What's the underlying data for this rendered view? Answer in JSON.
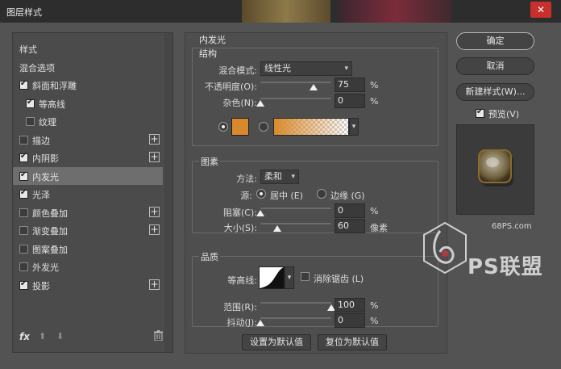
{
  "window": {
    "title": "图层样式",
    "close_glyph": "✕"
  },
  "style_list": {
    "items": [
      {
        "label": "样式",
        "checkbox": false,
        "checked": false,
        "indent": 0,
        "plus": false
      },
      {
        "label": "混合选项",
        "checkbox": false,
        "checked": false,
        "indent": 0,
        "plus": false
      },
      {
        "label": "斜面和浮雕",
        "checkbox": true,
        "checked": true,
        "indent": 0,
        "plus": false
      },
      {
        "label": "等高线",
        "checkbox": true,
        "checked": true,
        "indent": 1,
        "plus": false
      },
      {
        "label": "纹理",
        "checkbox": true,
        "checked": false,
        "indent": 1,
        "plus": false
      },
      {
        "label": "描边",
        "checkbox": true,
        "checked": false,
        "indent": 0,
        "plus": true
      },
      {
        "label": "内阴影",
        "checkbox": true,
        "checked": true,
        "indent": 0,
        "plus": true
      },
      {
        "label": "内发光",
        "checkbox": true,
        "checked": true,
        "indent": 0,
        "plus": false,
        "selected": true
      },
      {
        "label": "光泽",
        "checkbox": true,
        "checked": true,
        "indent": 0,
        "plus": false
      },
      {
        "label": "颜色叠加",
        "checkbox": true,
        "checked": false,
        "indent": 0,
        "plus": true
      },
      {
        "label": "渐变叠加",
        "checkbox": true,
        "checked": false,
        "indent": 0,
        "plus": true
      },
      {
        "label": "图案叠加",
        "checkbox": true,
        "checked": false,
        "indent": 0,
        "plus": false
      },
      {
        "label": "外发光",
        "checkbox": true,
        "checked": false,
        "indent": 0,
        "plus": false
      },
      {
        "label": "投影",
        "checkbox": true,
        "checked": true,
        "indent": 0,
        "plus": true
      }
    ],
    "fx_label": "fx",
    "up_glyph": "⬆",
    "down_glyph": "⬇"
  },
  "panel": {
    "title": "内发光",
    "structure": {
      "title": "结构",
      "blend_mode_label": "混合模式:",
      "blend_mode_value": "线性光",
      "opacity_label": "不透明度(O):",
      "opacity_value": "75",
      "opacity_fraction": 0.75,
      "noise_label": "杂色(N):",
      "noise_value": "0",
      "noise_fraction": 0,
      "percent": "%",
      "color_swatch": "#d9892b",
      "color_mode": "solid"
    },
    "elements": {
      "title": "图素",
      "method_label": "方法:",
      "method_value": "柔和",
      "source_label": "源:",
      "source_center_label": "居中 (E)",
      "source_edge_label": "边缘 (G)",
      "source_selected": "center",
      "choke_label": "阻塞(C):",
      "choke_value": "0",
      "choke_fraction": 0,
      "size_label": "大小(S):",
      "size_value": "60",
      "size_fraction": 0.24,
      "percent": "%",
      "pixel_unit": "像素"
    },
    "quality": {
      "title": "品质",
      "contour_label": "等高线:",
      "antialias_label": "消除锯齿 (L)",
      "antialias_checked": false,
      "range_label": "范围(R):",
      "range_value": "100",
      "range_fraction": 1.0,
      "jitter_label": "抖动(J):",
      "jitter_value": "0",
      "jitter_fraction": 0,
      "percent": "%"
    },
    "make_default_label": "设置为默认值",
    "reset_default_label": "复位为默认值"
  },
  "actions": {
    "ok_label": "确定",
    "cancel_label": "取消",
    "new_style_label": "新建样式(W)...",
    "preview_label": "预览(V)",
    "preview_checked": true
  },
  "watermark": {
    "site": "68PS.com",
    "text": "PS联盟"
  },
  "colors": {
    "accent": "#d9892b",
    "dialog_bg": "#535353",
    "selected_row": "#6e6e6e"
  }
}
